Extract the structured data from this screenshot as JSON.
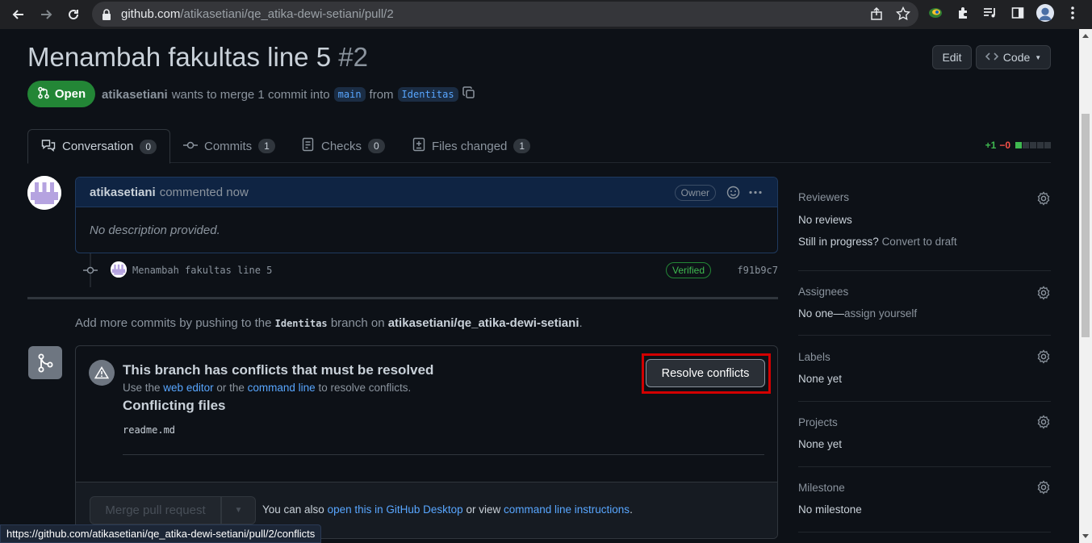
{
  "browser": {
    "url_host": "github.com",
    "url_path": "/atikasetiani/qe_atika-dewi-setiani/pull/2"
  },
  "pr": {
    "title": "Menambah fakultas line 5",
    "number": "#2",
    "edit_label": "Edit",
    "code_label": "Code",
    "state": "Open",
    "author": "atikasetiani",
    "merge_text": "wants to merge 1 commit into",
    "base_branch": "main",
    "from_text": "from",
    "head_branch": "Identitas"
  },
  "tabs": [
    {
      "label": "Conversation",
      "count": "0"
    },
    {
      "label": "Commits",
      "count": "1"
    },
    {
      "label": "Checks",
      "count": "0"
    },
    {
      "label": "Files changed",
      "count": "1"
    }
  ],
  "diffstat": {
    "additions": "+1",
    "deletions": "−0",
    "colors": [
      "#3fb950",
      "#30363d",
      "#30363d",
      "#30363d",
      "#30363d"
    ]
  },
  "comment": {
    "author": "atikasetiani",
    "action": "commented now",
    "role": "Owner",
    "body": "No description provided."
  },
  "commit": {
    "message": "Menambah fakultas line 5",
    "verified": "Verified",
    "sha": "f91b9c7"
  },
  "push_note": {
    "prefix": "Add more commits by pushing to the",
    "branch": "Identitas",
    "middle": "branch on",
    "repo": "atikasetiani/qe_atika-dewi-setiani",
    "suffix": "."
  },
  "merge": {
    "conflict_title": "This branch has conflicts that must be resolved",
    "sub_prefix": "Use the",
    "web_editor": "web editor",
    "sub_middle": "or the",
    "command_line": "command line",
    "sub_suffix": "to resolve conflicts.",
    "files_title": "Conflicting files",
    "file": "readme.md",
    "resolve_label": "Resolve conflicts",
    "merge_label": "Merge pull request",
    "footer_prefix": "You can also",
    "footer_link1": "open this in GitHub Desktop",
    "footer_middle": "or view",
    "footer_link2": "command line instructions",
    "footer_suffix": "."
  },
  "sidebar": {
    "reviewers": {
      "title": "Reviewers",
      "value": "No reviews",
      "progress_prefix": "Still in progress?",
      "progress_link": "Convert to draft"
    },
    "assignees": {
      "title": "Assignees",
      "value_prefix": "No one—",
      "value_link": "assign yourself"
    },
    "labels": {
      "title": "Labels",
      "value": "None yet"
    },
    "projects": {
      "title": "Projects",
      "value": "None yet"
    },
    "milestone": {
      "title": "Milestone",
      "value": "No milestone"
    }
  },
  "status_url": "https://github.com/atikasetiani/qe_atika-dewi-setiani/pull/2/conflicts"
}
